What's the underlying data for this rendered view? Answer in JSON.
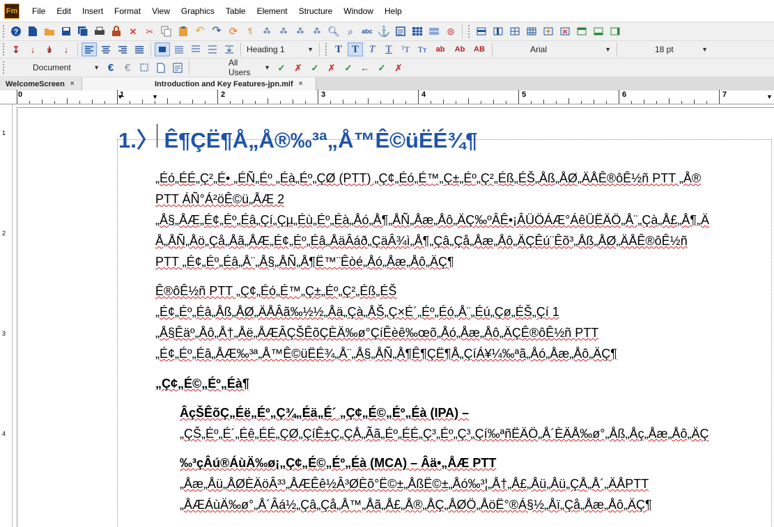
{
  "app": {
    "logo": "Fm"
  },
  "menu": [
    "File",
    "Edit",
    "Insert",
    "Format",
    "View",
    "Graphics",
    "Table",
    "Element",
    "Structure",
    "Window",
    "Help"
  ],
  "toolbar2": {
    "paragraph_tag": "Heading 1",
    "font": "Arial",
    "size": "18 pt",
    "char_btns": [
      "ab",
      "Ab",
      "AB"
    ]
  },
  "toolbar3": {
    "view": "Document",
    "users": "All Users"
  },
  "tabs": [
    {
      "label": "WelcomeScreen",
      "close": "×"
    },
    {
      "label": "Introduction and Key Features-jpn.mif",
      "close": "×"
    }
  ],
  "ruler": {
    "numbers": [
      "0",
      "1",
      "2",
      "3",
      "4",
      "5",
      "6",
      "7"
    ]
  },
  "vruler": {
    "numbers": [
      "1",
      "2",
      "3",
      "4"
    ]
  },
  "document": {
    "heading": "1.〉 Ê¶ÇË¶Å„Å®‰³ª„Å™Ê©üËÉ¾¶",
    "p1": [
      "„Éó„ÉÉ„Ç²„É• „ÉÑ„Éº „Éà„Éº„ÇØ (PTT) „Ç¢„Éó„É™„Ç±„Éº„Ç²„Éß„ÉŠ„Åß„ÅØ„ÄÅÊ®ôÊ½ñ PTT „Å®",
      "PTT ÁÑ°Á²öÊ©ü„ÅÆ 2",
      "„Å§„ÅÆ„É¢„Éº„Éâ„Çí„Çµ„Éù„Éº„Éà„Åó„Å¶„ÅÑ„Åæ„Åô„ÄÇ‰ºÂÊ•¡ÂÜÖÁÆ°ÁêÜËÄÖ„Å¨„Çà„Å£„Å¶„Ä",
      "Å„ÅÑ„Åö„Çå„Åã„ÅÆ„É¢„Éº„Éâ„ÅäÂáð„ÇäÂ¾ì„Å¶„Çâ„Çå„Åæ„Åô„ÄÇÊú¨Êõ³„Åß„ÅØ„ÄÅÊ®ôÊ½ñ",
      "PTT „É¢„Éº„Éâ„Å¨„Å§„ÅÑ„Å¶Ë™¨Êòé„Åó„Åæ„Åô„ÄÇ¶"
    ],
    "p2": [
      "Ê®ôÊ½ñ PTT „Ç¢„Éó„É™„Ç±„Éº„Ç²„Éß„ÉŠ",
      "„É¢„Éº„Éâ„Åß„ÅØ„ÄÅÂã‰½½„Åä„Çà„ÅŠ„Ç×É´„Éº„Éó„Å¨„Éú„Çø„ÉŠ„Çí 1",
      "„Å§Êäº„Åô„Å†„Åë„ÅÆÂÇŠÊõÇÈÄ‰ø°ÇíÊèê‰œõ„Åó„Åæ„Åô„ÄÇÊ®ôÊ½ñ PTT",
      "„É¢„Éº„Éâ„ÅÆ‰³ª„Å™Ê©üËÉ¾„Å¨„Å§„ÅÑ„Å¶Ê¶ÇË¶Å„ÇíÁ¥¼‰ªã„Åó„Åæ„Åô„ÄÇ¶"
    ],
    "h2": "„Ç¢„É©„Éº„Éà¶",
    "ipa_title": "ÂçŠÊõÇ„Éë„Éº„Ç¾„Éä„É´ „Ç¢„É©„Éº„Éà (IPA) –",
    "ipa_body": "„ÇŠ„Éº„É´„Éê„ÉÉ„ÇØ„ÇíÊ±Ç„ÇÅ„Ãã„Éº„ÉÉ„Ç³„Éº„Ç³„Çí‰ªñËÄÖ„Å´ÈÄÅ‰ø°„Åß„Åç„Åæ„Åô„ÄÇ",
    "mca_title": "‰³çÂú®ÁùÄ‰ø¡„Ç¢„É©„Éº„Éà (MCA) – Âä•„ÅÆ PTT",
    "mca_body": [
      "„Åæ„Åü„ÅØÈÄöÂ³³„ÅÆÊê½Â³ØÈõ°Ë©±„ÅßË©±„Åó‰³¦„Å†„Å£„Åü„Åü„ÇÅ„Å´„ÄÅPTT",
      "„ÅÆÁùÄ‰ø°„Å´Âá½„Çâ„Çå„Å™„Åã„Å£„Å®„ÅÇ„ÅØÖ„ÅöË°®Á§½„Åï„Çå„Åæ„Åô„ÄÇ¶"
    ]
  }
}
